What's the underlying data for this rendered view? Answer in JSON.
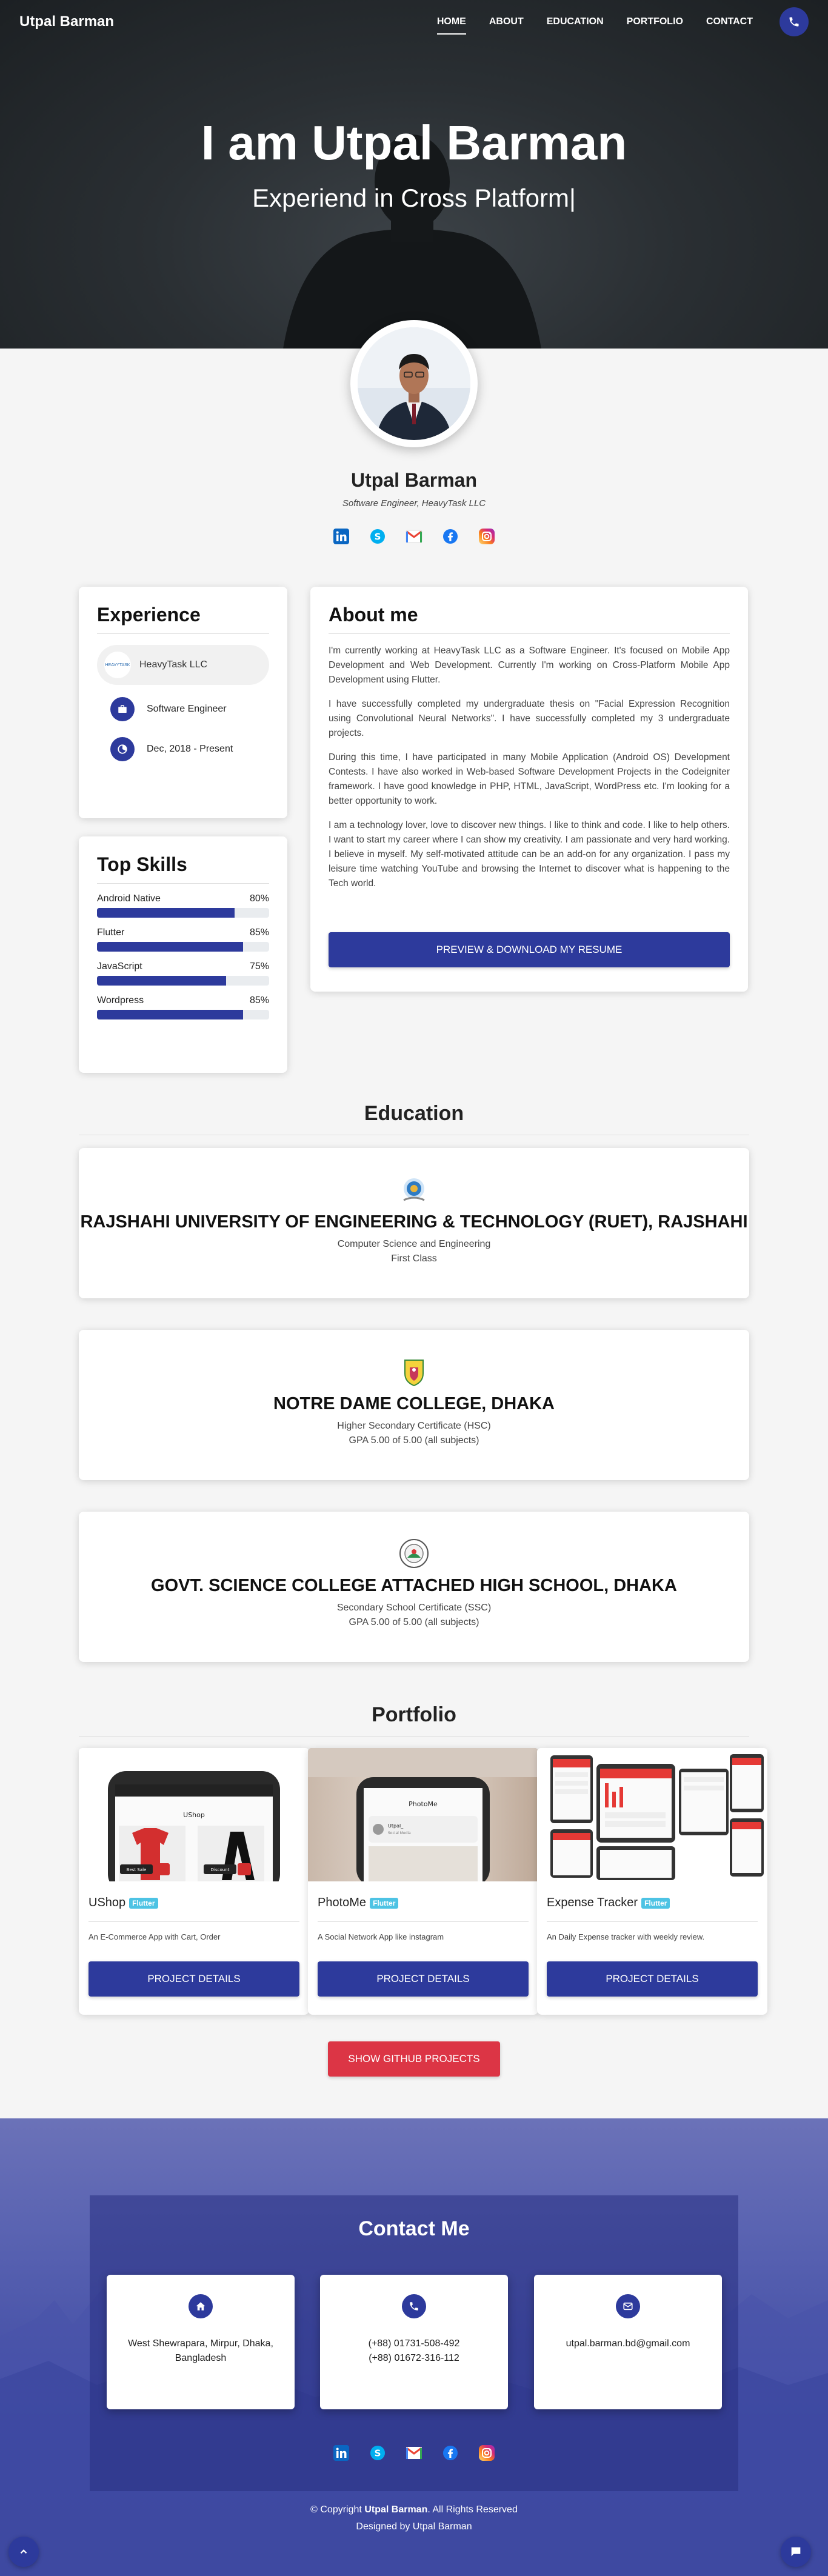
{
  "nav": {
    "brand": "Utpal Barman",
    "links": [
      "HOME",
      "ABOUT",
      "EDUCATION",
      "PORTFOLIO",
      "CONTACT"
    ],
    "active": "HOME",
    "phone_icon": "phone-icon"
  },
  "hero": {
    "title": "I am Utpal Barman",
    "subtitle": "Experiend in Cross Platform|"
  },
  "profile": {
    "name": "Utpal Barman",
    "role": "Software Engineer, HeavyTask LLC",
    "socials": [
      "linkedin-icon",
      "skype-icon",
      "gmail-icon",
      "facebook-icon",
      "instagram-icon"
    ]
  },
  "experience": {
    "title": "Experience",
    "company": "HeavyTask LLC",
    "logo_text": "HEAVYTASK",
    "position": "Software Engineer",
    "period": "Dec, 2018 - Present"
  },
  "skills": {
    "title": "Top Skills",
    "items": [
      {
        "name": "Android Native",
        "percent_label": "80%",
        "value": 80
      },
      {
        "name": "Flutter",
        "percent_label": "85%",
        "value": 85
      },
      {
        "name": "JavaScript",
        "percent_label": "75%",
        "value": 75
      },
      {
        "name": "Wordpress",
        "percent_label": "85%",
        "value": 85
      }
    ]
  },
  "about": {
    "title": "About me",
    "paragraphs": [
      "I'm currently working at HeavyTask LLC as a Software Engineer. It's focused on Mobile App Development and Web Development. Currently I'm working on Cross-Platform Mobile App Development using Flutter.",
      "I have successfully completed my undergraduate thesis on \"Facial Expression Recognition using Convolutional Neural Networks\". I have successfully completed my 3 undergraduate projects.",
      "During this time, I have participated in many Mobile Application (Android OS) Development Contests. I have also worked in Web-based Software Development Projects in the Codeigniter framework. I have good knowledge in PHP, HTML, JavaScript, WordPress etc. I'm looking for a better opportunity to work.",
      "I am a technology lover, love to discover new things. I like to think and code. I like to help others. I want to start my career where I can show my creativity. I am passionate and very hard working. I believe in myself. My self-motivated attitude can be an add-on for any organization. I pass my leisure time watching YouTube and browsing the Internet to discover what is happening to the Tech world."
    ],
    "resume_button": "PREVIEW & DOWNLOAD MY RESUME"
  },
  "education": {
    "title": "Education",
    "items": [
      {
        "name": "RAJSHAHI UNIVERSITY OF ENGINEERING & TECHNOLOGY (RUET), RAJSHAHI",
        "line1": "Computer Science and Engineering",
        "line2": "First Class"
      },
      {
        "name": "NOTRE DAME COLLEGE, DHAKA",
        "line1": "Higher Secondary Certificate (HSC)",
        "line2": "GPA 5.00 of 5.00 (all subjects)"
      },
      {
        "name": "GOVT. SCIENCE COLLEGE ATTACHED HIGH SCHOOL, DHAKA",
        "line1": "Secondary School Certificate (SSC)",
        "line2": "GPA 5.00 of 5.00 (all subjects)"
      }
    ]
  },
  "portfolio": {
    "title": "Portfolio",
    "items": [
      {
        "title": "UShop",
        "badge": "Flutter",
        "desc": "An E-Commerce App with Cart, Order",
        "button": "PROJECT DETAILS",
        "screen_text": "UShop",
        "screen_btn1": "Best Sale",
        "screen_btn2": "Discount"
      },
      {
        "title": "PhotoMe",
        "badge": "Flutter",
        "desc": "A Social Network App like instagram",
        "button": "PROJECT DETAILS",
        "screen_text": "PhotoMe",
        "screen_user": "Utpal_",
        "screen_sub": "Social Media"
      },
      {
        "title": "Expense Tracker",
        "badge": "Flutter",
        "desc": "An Daily Expense tracker with weekly review.",
        "button": "PROJECT DETAILS"
      }
    ],
    "github_button": "SHOW GITHUB PROJECTS"
  },
  "contact": {
    "title": "Contact Me",
    "cards": [
      {
        "icon": "home-icon",
        "lines": [
          "West Shewrapara, Mirpur, Dhaka,",
          "Bangladesh"
        ]
      },
      {
        "icon": "phone-icon",
        "lines": [
          "(+88) 01731-508-492",
          "(+88) 01672-316-112"
        ]
      },
      {
        "icon": "email-icon",
        "lines": [
          "utpal.barman.bd@gmail.com"
        ]
      }
    ],
    "socials": [
      "linkedin-icon",
      "skype-icon",
      "gmail-icon",
      "facebook-icon",
      "instagram-icon"
    ]
  },
  "footer": {
    "copy_prefix": "© Copyright",
    "copy_name": "Utpal Barman",
    "copy_suffix": ". All Rights Reserved",
    "designed": "Designed by Utpal Barman"
  },
  "colors": {
    "primary": "#2d3a9c",
    "danger": "#dc3545",
    "badge": "#4dc3e4"
  }
}
